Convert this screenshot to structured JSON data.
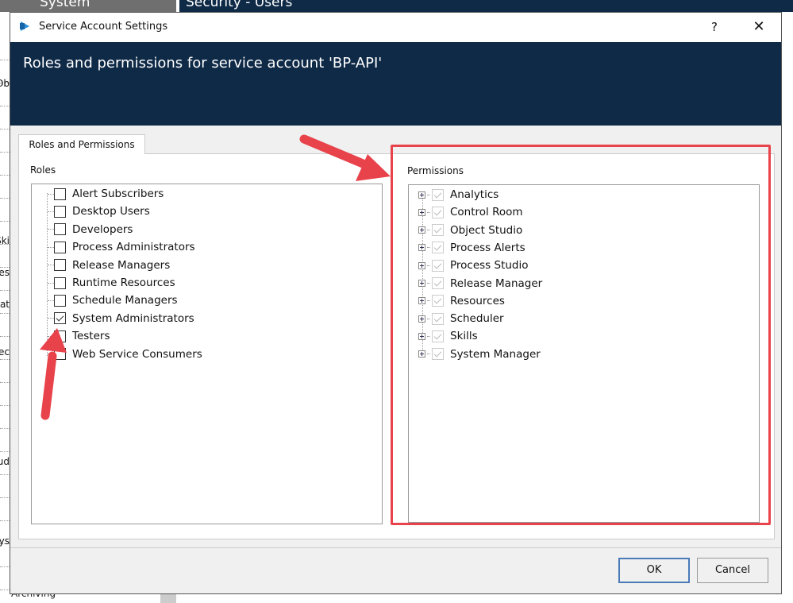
{
  "background": {
    "tab_left": "System",
    "tab_right": "Security - Users",
    "left_fragments": [
      "Ob",
      "Ski",
      "es",
      "at",
      "ec",
      "ud",
      "ys"
    ],
    "bottom_item": "Archiving"
  },
  "dialog": {
    "title": "Service Account Settings",
    "help": "?",
    "close": "✕",
    "header": "Roles and permissions for service account 'BP-API'",
    "tab": "Roles and Permissions",
    "roles": {
      "label": "Roles",
      "items": [
        {
          "label": "Alert Subscribers",
          "checked": false
        },
        {
          "label": "Desktop Users",
          "checked": false
        },
        {
          "label": "Developers",
          "checked": false
        },
        {
          "label": "Process Administrators",
          "checked": false
        },
        {
          "label": "Release Managers",
          "checked": false
        },
        {
          "label": "Runtime Resources",
          "checked": false
        },
        {
          "label": "Schedule Managers",
          "checked": false
        },
        {
          "label": "System Administrators",
          "checked": true
        },
        {
          "label": "Testers",
          "checked": false
        },
        {
          "label": "Web Service Consumers",
          "checked": false
        }
      ]
    },
    "permissions": {
      "label": "Permissions",
      "items": [
        {
          "label": "Analytics",
          "checked": true
        },
        {
          "label": "Control Room",
          "checked": true
        },
        {
          "label": "Object Studio",
          "checked": true
        },
        {
          "label": "Process Alerts",
          "checked": true
        },
        {
          "label": "Process Studio",
          "checked": true
        },
        {
          "label": "Release Manager",
          "checked": true
        },
        {
          "label": "Resources",
          "checked": true
        },
        {
          "label": "Scheduler",
          "checked": true
        },
        {
          "label": "Skills",
          "checked": true
        },
        {
          "label": "System Manager",
          "checked": true
        }
      ]
    },
    "ok": "OK",
    "cancel": "Cancel"
  },
  "colors": {
    "header": "#0f2a47",
    "annotation": "#e8434b"
  }
}
